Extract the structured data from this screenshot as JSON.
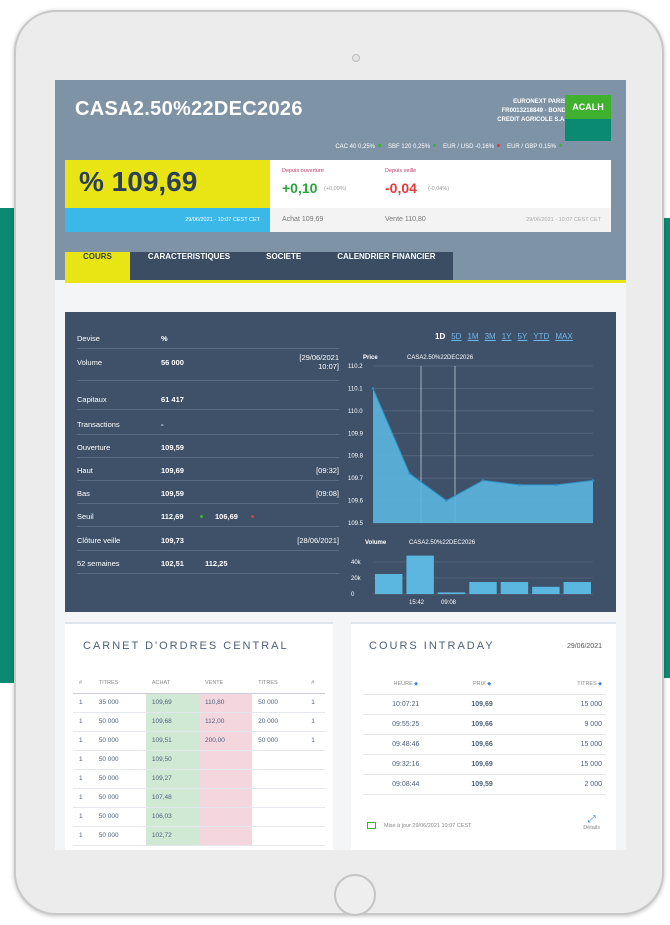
{
  "header": {
    "title": "CASA2.50%22DEC2026",
    "exchange": "EURONEXT PARIS",
    "isin": "FR0013218849 - BOND",
    "issuer": "CREDIT AGRICOLE S.A.",
    "badge": "ACALH",
    "indices": [
      {
        "label": "CAC 40 0,25%",
        "dir": "up"
      },
      {
        "label": "SBF 120 0,25%",
        "dir": "up"
      },
      {
        "label": "EUR / USD -0,16%",
        "dir": "down"
      },
      {
        "label": "EUR / GBP 0,15%",
        "dir": "up"
      }
    ]
  },
  "quote": {
    "price": "% 109,69",
    "price_time": "29/06/2021 - 10:07 CEST  CET",
    "since_open_label": "Depuis ouverture",
    "since_open_value": "+0,10",
    "since_open_pct": "(+0,09%)",
    "since_prev_label": "Depuis veille",
    "since_prev_value": "-0,04",
    "since_prev_pct": "(-0,04%)",
    "achat": "Achat 109,69",
    "vente": "Vente 110,80",
    "time2": "29/06/2021 - 10:07 CEST  CET"
  },
  "tabs": [
    "COURS",
    "CARACTERISTIQUES",
    "SOCIETE",
    "CALENDRIER FINANCIER"
  ],
  "details": [
    {
      "k": "Devise",
      "v": "%",
      "d": ""
    },
    {
      "k": "Volume",
      "v": "56 000",
      "d": "[29/06/2021",
      "d2": "10:07]"
    },
    {
      "k": "Capitaux",
      "v": "61 417",
      "d": ""
    },
    {
      "k": "Transactions",
      "v": "-",
      "d": ""
    },
    {
      "k": "Ouverture",
      "v": "109,59",
      "d": ""
    },
    {
      "k": "Haut",
      "v": "109,69",
      "d": "[09:32]"
    },
    {
      "k": "Bas",
      "v": "109,59",
      "d": "[09:08]"
    },
    {
      "k": "Seuil",
      "v": "112,69",
      "v2": "106,69",
      "d": ""
    },
    {
      "k": "Clôture veille",
      "v": "109,73",
      "d": "[28/06/2021]"
    },
    {
      "k": "52 semaines",
      "v": "102,51",
      "v2": "112,25",
      "d": ""
    }
  ],
  "ranges": [
    "1D",
    "5D",
    "1M",
    "3M",
    "1Y",
    "5Y",
    "YTD",
    "MAX"
  ],
  "chart_data": [
    {
      "type": "area",
      "series": [
        {
          "name": "CASA2.50%22DEC2026",
          "values": [
            110.1,
            109.72,
            109.6,
            109.69,
            109.67,
            109.67,
            109.69
          ]
        }
      ],
      "ylabel": "Price",
      "y_ticks": [
        "110.2",
        "110.1",
        "110.0",
        "109.9",
        "109.8",
        "109.7",
        "109.6",
        "109.5"
      ],
      "ylim": [
        109.5,
        110.2
      ]
    },
    {
      "type": "bar",
      "series": [
        {
          "name": "CASA2.50%22DEC2026",
          "values": [
            25000,
            48000,
            2000,
            15000,
            15000,
            9000,
            15000
          ]
        }
      ],
      "ylabel": "Volume",
      "y_ticks": [
        "40k",
        "20k",
        "0"
      ],
      "ylim": [
        0,
        50000
      ],
      "x_ticks": [
        "15:42",
        "09:08"
      ]
    }
  ],
  "carnet": {
    "title": "CARNET D'ORDRES CENTRAL",
    "headers": [
      "#",
      "TITRES",
      "ACHAT",
      "VENTE",
      "TITRES",
      "#"
    ],
    "rows": [
      [
        "1",
        "35 000",
        "109,69",
        "110,80",
        "50 000",
        "1"
      ],
      [
        "1",
        "50 000",
        "109,68",
        "112,00",
        "20 000",
        "1"
      ],
      [
        "1",
        "50 000",
        "109,51",
        "200,00",
        "50 000",
        "1"
      ],
      [
        "1",
        "50 000",
        "109,50",
        "",
        "",
        ""
      ],
      [
        "1",
        "50 000",
        "109,27",
        "",
        "",
        ""
      ],
      [
        "1",
        "50 000",
        "107,48",
        "",
        "",
        ""
      ],
      [
        "1",
        "50 000",
        "106,03",
        "",
        "",
        ""
      ],
      [
        "1",
        "50 000",
        "102,72",
        "",
        "",
        ""
      ]
    ]
  },
  "intraday": {
    "title": "COURS INTRADAY",
    "date": "29/06/2021",
    "headers": [
      "HEURE",
      "PRIX",
      "TITRES"
    ],
    "rows": [
      [
        "10:07:21",
        "109,69",
        "15 000"
      ],
      [
        "09:55:25",
        "109,66",
        "9 000"
      ],
      [
        "09:48:46",
        "109,66",
        "15 000"
      ],
      [
        "09:32:16",
        "109,69",
        "15 000"
      ],
      [
        "09:08:44",
        "109,59",
        "2 000"
      ]
    ],
    "updated": "Mise à jour 29/06/2021 10:07 CEST",
    "details": "Détails"
  },
  "colors": {
    "accent": "#e9e515",
    "up": "#3fb12f",
    "down": "#e23b3b",
    "panel": "#3f5169"
  }
}
